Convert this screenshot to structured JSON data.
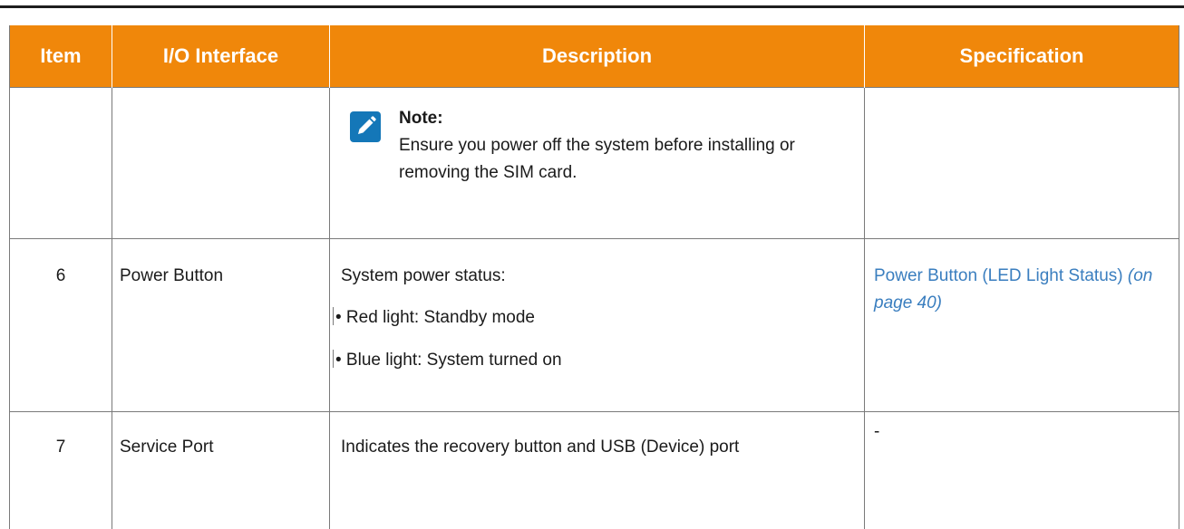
{
  "table": {
    "headers": {
      "item": "Item",
      "io_interface": "I/O Interface",
      "description": "Description",
      "specification": "Specification"
    },
    "note_row": {
      "note_title": "Note:",
      "note_body": "Ensure you power off the system before installing or removing the SIM card."
    },
    "rows": [
      {
        "item": "6",
        "io_interface": "Power Button",
        "description_intro": "System power status:",
        "bullets": [
          "• Red light: Standby mode",
          "• Blue light: System turned on"
        ],
        "spec_link_text": "Power Button (LED Light Status)",
        "spec_link_page": "(on page 40)"
      },
      {
        "item": "7",
        "io_interface": "Service Port",
        "description": "Indicates the recovery button and USB (Device) port",
        "specification": "-"
      }
    ]
  },
  "colors": {
    "header_bg": "#f0870a",
    "header_text": "#ffffff",
    "link": "#3a7ebf",
    "note_icon": "#1477b8",
    "border": "#7a7a7a"
  },
  "icons": {
    "note": "pencil-icon"
  }
}
